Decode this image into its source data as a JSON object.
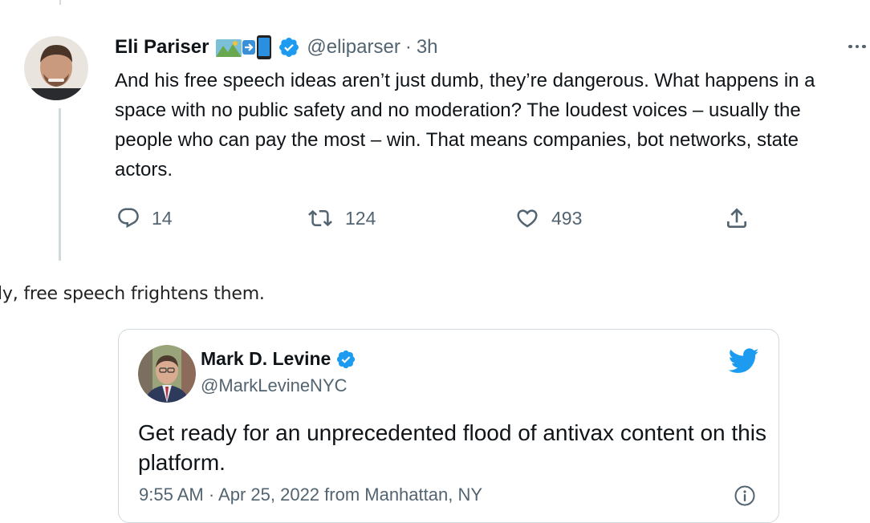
{
  "tweet": {
    "author_name": "Eli Pariser",
    "handle": "@eliparser",
    "separator": "·",
    "time": "3h",
    "body": "And his free speech ideas aren’t just dumb, they’re dangerous. What happens in a space with no public safety and no moderation? The loudest voices – usually the people who can pay the most – win. That means companies, bot networks, state actors.",
    "stats": {
      "replies": "14",
      "retweets": "124",
      "likes": "493"
    },
    "icons": [
      "map-emoji-icon",
      "arrow-emoji-icon",
      "phone-emoji-icon",
      "verified-badge-icon",
      "more-icon",
      "reply-icon",
      "retweet-icon",
      "like-icon",
      "share-icon"
    ]
  },
  "caption": "ly, free speech frightens them.",
  "embedded_tweet": {
    "author_name": "Mark D. Levine",
    "handle": "@MarkLevineNYC",
    "body": "Get ready for an unprecedented flood of antivax content on this platform.",
    "meta": "9:55 AM · Apr 25, 2022 from Manhattan, NY",
    "icons": [
      "verified-badge-icon",
      "twitter-bird-icon",
      "info-icon"
    ]
  },
  "colors": {
    "text": "#0f1419",
    "secondary": "#536471",
    "verified_blue": "#1d9bf0",
    "border": "#cfd9de"
  }
}
